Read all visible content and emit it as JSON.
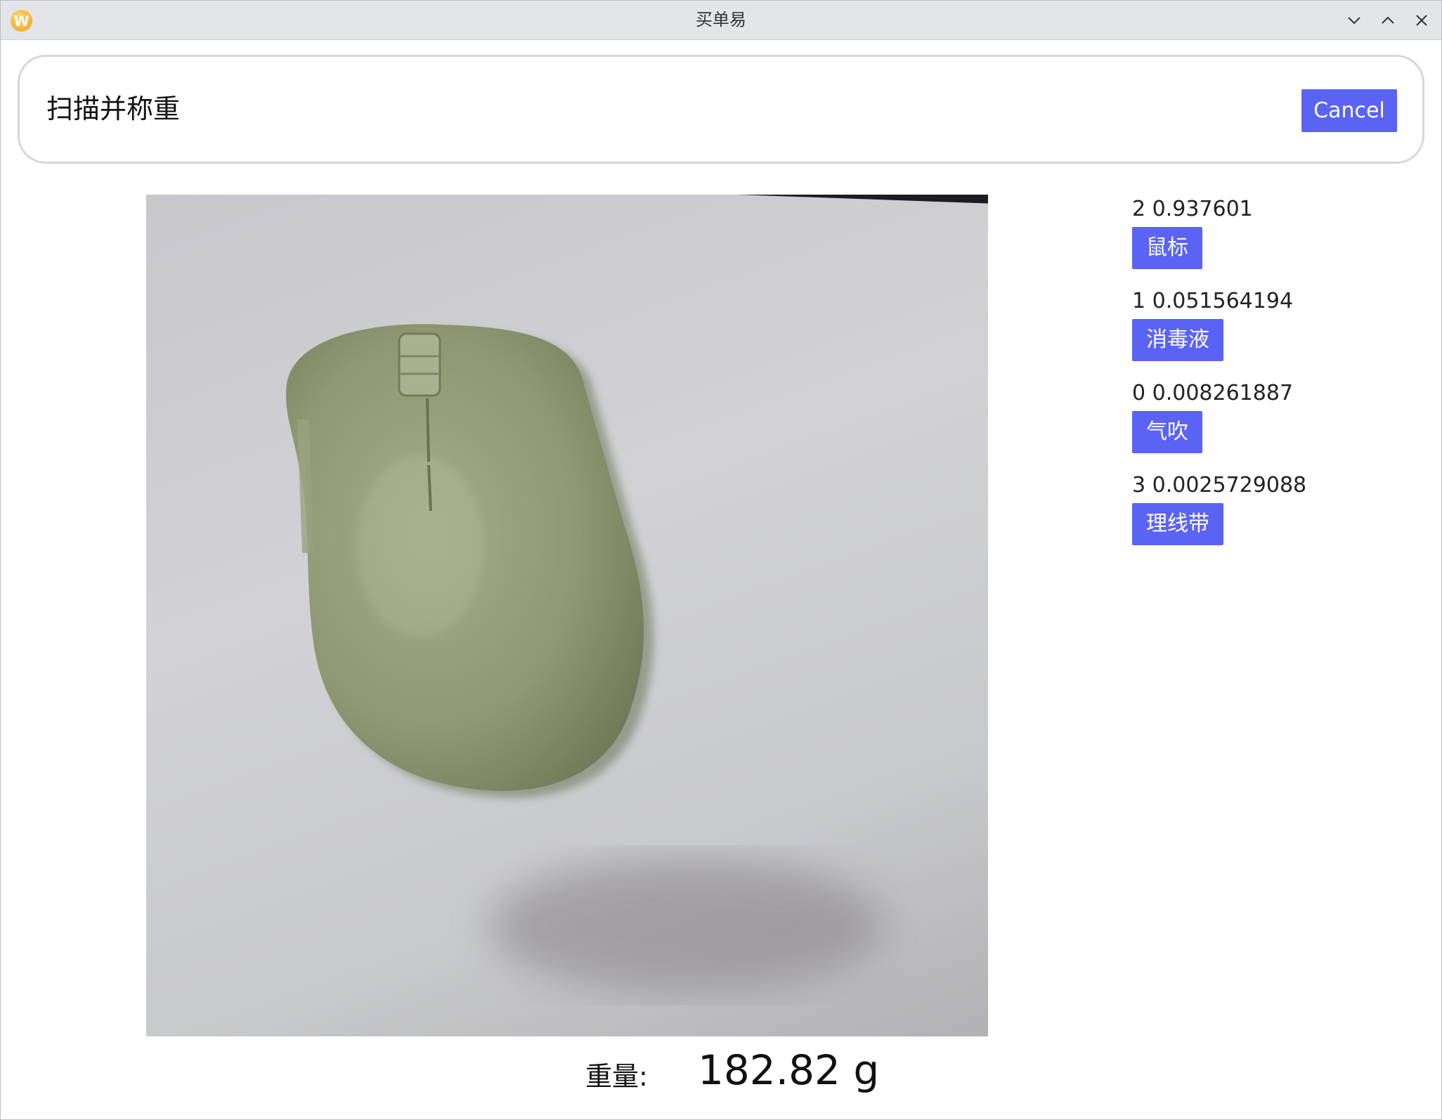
{
  "window": {
    "title": "买单易",
    "icon_letter": "W"
  },
  "header": {
    "title": "扫描并称重",
    "cancel_label": "Cancel"
  },
  "camera": {
    "subject": "computer mouse photo"
  },
  "results": [
    {
      "score": "2 0.937601",
      "label": "鼠标"
    },
    {
      "score": "1 0.051564194",
      "label": "消毒液"
    },
    {
      "score": "0 0.008261887",
      "label": "气吹"
    },
    {
      "score": "3 0.0025729088",
      "label": "理线带"
    }
  ],
  "weight": {
    "label": "重量:",
    "value": "182.82 g"
  },
  "colors": {
    "accent": "#5b63f5",
    "titlebar": "#e3e5e8",
    "mouse": "#8e9872"
  }
}
